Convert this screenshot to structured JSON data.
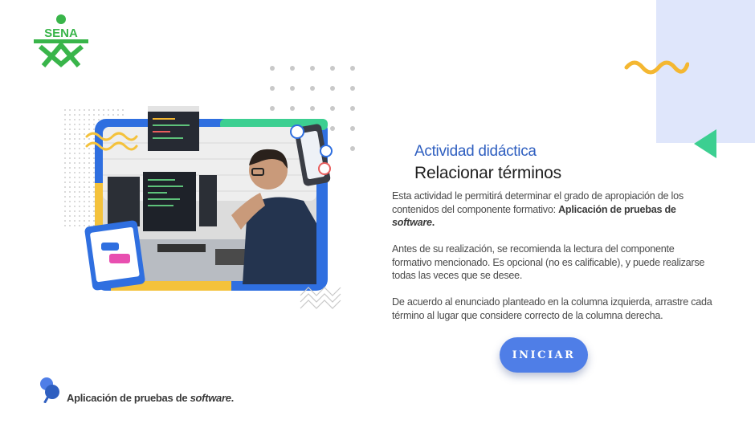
{
  "logo": {
    "text": "SENA",
    "color": "#39b54a"
  },
  "content": {
    "subtitle": "Actividad didáctica",
    "title": "Relacionar términos",
    "p1_text": "Esta actividad le permitirá determinar el grado de apropiación de los contenidos del componente formativo: ",
    "p1_bold": "Aplicación de pruebas de ",
    "p1_bold_italic": "software",
    "p1_end": ".",
    "p2": "Antes de su realización, se recomienda la lectura del componente formativo mencionado.  Es opcional (no es calificable), y puede realizarse todas las veces que se desee.",
    "p3": "De acuerdo al enunciado planteado en la columna izquierda, arrastre cada término al lugar que considere correcto de la columna derecha."
  },
  "button": {
    "label": "INICIAR",
    "color": "#4f7ee7"
  },
  "footer": {
    "text": "Aplicación de pruebas de ",
    "italic": "software",
    "end": "."
  },
  "colors": {
    "accent_blue": "#2f5fc0",
    "deco_light": "#dfe6fb",
    "wave": "#f4b731",
    "triangle": "#3ccf91"
  }
}
